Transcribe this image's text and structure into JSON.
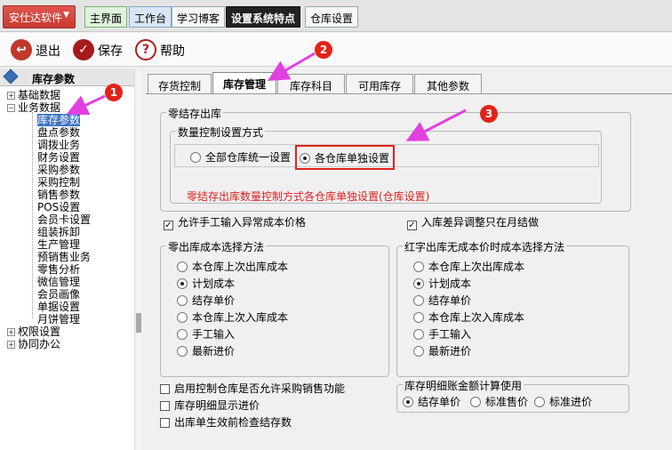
{
  "app": {
    "name": "安仕达软件"
  },
  "top_tabs": [
    "主界面",
    "工作台",
    "学习博客",
    "设置系统特点",
    "仓库设置"
  ],
  "toolbar": {
    "exit": "退出",
    "save": "保存",
    "help": "帮助"
  },
  "sidebar": {
    "title": "库存参数",
    "items": [
      "基础数据",
      "业务数据",
      "库存参数",
      "盘点参数",
      "调拨业务",
      "财务设置",
      "采购参数",
      "采购控制",
      "销售参数",
      "POS设置",
      "会员卡设置",
      "组装拆卸",
      "生产管理",
      "预销售业务",
      "零售分析",
      "微信管理",
      "会员画像",
      "单据设置",
      "月饼管理",
      "权限设置",
      "协同办公"
    ]
  },
  "tabs": [
    "存货控制",
    "库存管理",
    "库存科目",
    "可用库存",
    "其他参数"
  ],
  "zero_out": {
    "group_title": "零结存出库",
    "mode_title": "数量控制设置方式",
    "opt_all": "全部仓库统一设置",
    "opt_each": "各仓库单独设置",
    "note": "零结存出库数量控制方式各仓库单独设置(仓库设置)"
  },
  "checks": {
    "manual_abnormal": "允许手工输入异常成本价格",
    "month_end": "入库差异调整只在月结做"
  },
  "zero_cost": {
    "title": "零出库成本选择方法",
    "options": [
      "本仓库上次出库成本",
      "计划成本",
      "结存单价",
      "本仓库上次入库成本",
      "手工输入",
      "最新进价"
    ]
  },
  "red_cost": {
    "title": "红字出库无成本价时成本选择方法",
    "options": [
      "本仓库上次出库成本",
      "计划成本",
      "结存单价",
      "本仓库上次入库成本",
      "手工输入",
      "最新进价"
    ]
  },
  "bottom_checks": [
    "启用控制仓库是否允许采购销售功能",
    "库存明细显示进价",
    "出库单生效前检查结存数"
  ],
  "detail_amount": {
    "title": "库存明细账金额计算使用",
    "options": [
      "结存单价",
      "标准售价",
      "标准进价"
    ]
  },
  "annotations": [
    "1",
    "2",
    "3"
  ],
  "colors": {
    "annotation": "#e2231a",
    "arrow": "#e040e0",
    "note": "#e02020",
    "selected": "#3b73c4"
  }
}
